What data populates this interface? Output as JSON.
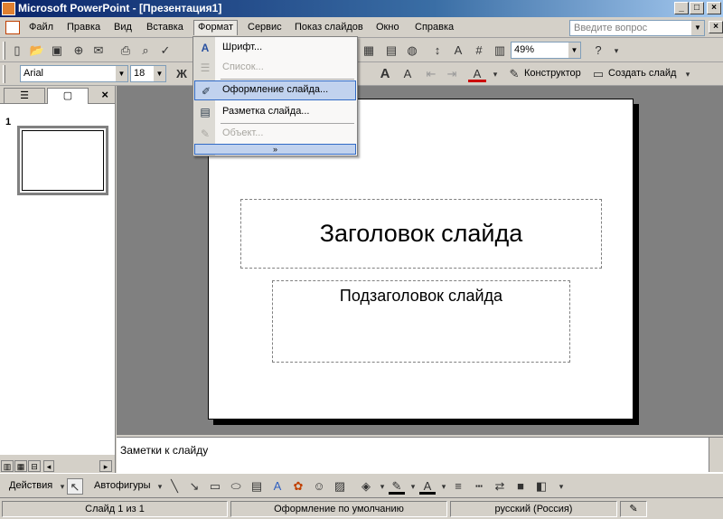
{
  "window": {
    "title": "Microsoft PowerPoint - [Презентация1]",
    "controls": [
      "_",
      "□",
      "×"
    ]
  },
  "menubar": {
    "items": [
      "Файл",
      "Правка",
      "Вид",
      "Вставка",
      "Формат",
      "Сервис",
      "Показ слайдов",
      "Окно",
      "Справка"
    ],
    "ask_placeholder": "Введите вопрос"
  },
  "toolbar_standard": {
    "zoom": "49%"
  },
  "toolbar_format": {
    "font": "Arial",
    "size": "18",
    "bold": "Ж",
    "designer_label": "Конструктор",
    "new_slide_label": "Создать слайд"
  },
  "format_menu": {
    "items": [
      {
        "label": "Шрифт...",
        "icon": "font-A-icon",
        "enabled": true
      },
      {
        "label": "Список...",
        "icon": "list-icon",
        "enabled": false
      },
      {
        "label": "Оформление слайда...",
        "icon": "slide-design-icon",
        "enabled": true,
        "highlighted": true
      },
      {
        "label": "Разметка слайда...",
        "icon": "slide-layout-icon",
        "enabled": true
      },
      {
        "label": "Объект...",
        "icon": "object-icon",
        "enabled": false
      }
    ],
    "expand": "»"
  },
  "left_panel": {
    "slide_number": "1"
  },
  "slide": {
    "title_placeholder": "Заголовок слайда",
    "subtitle_placeholder": "Подзаголовок слайда"
  },
  "notes": {
    "placeholder": "Заметки к слайду"
  },
  "drawbar": {
    "actions_label": "Действия",
    "autoshapes_label": "Автофигуры"
  },
  "statusbar": {
    "slide_info": "Слайд 1 из 1",
    "design": "Оформление по умолчанию",
    "language": "русский (Россия)"
  }
}
